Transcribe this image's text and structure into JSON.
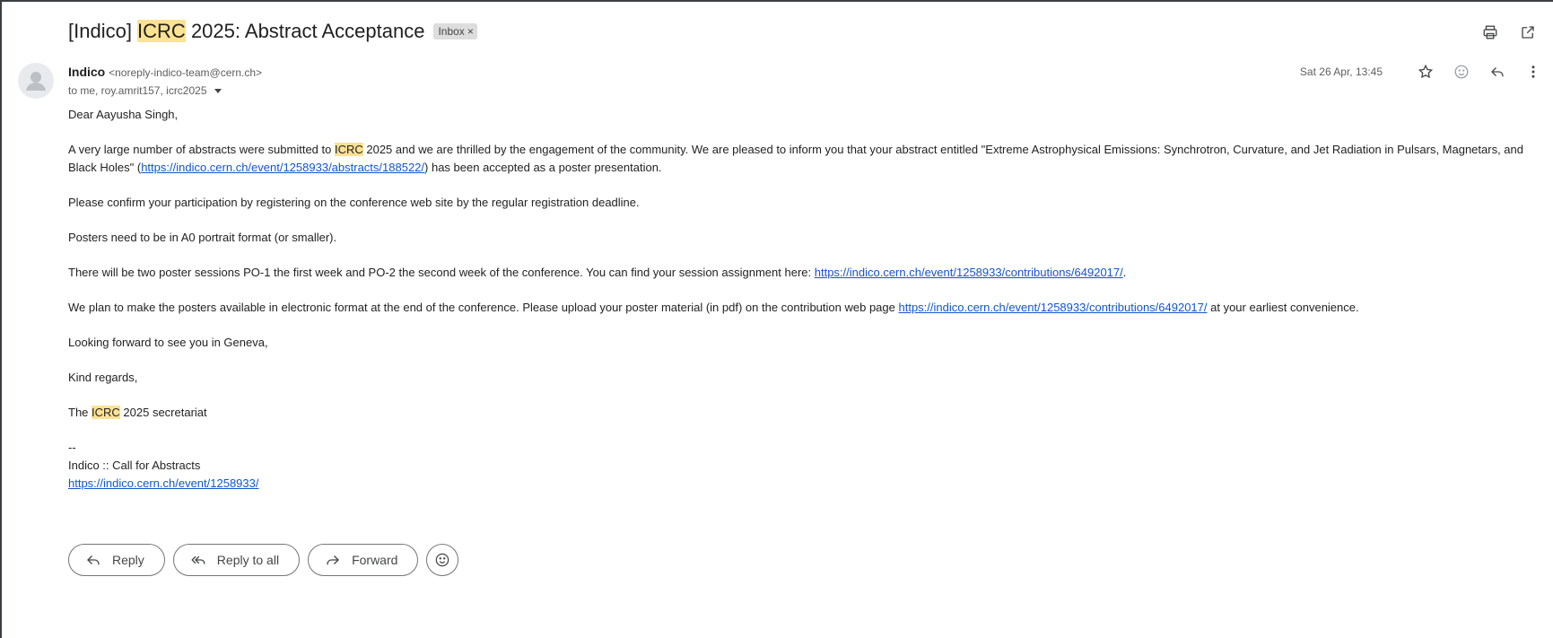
{
  "subject": {
    "prefix": "[Indico] ",
    "highlight": "ICRC",
    "suffix": " 2025: Abstract Acceptance",
    "label": "Inbox",
    "label_close": "×"
  },
  "sender": {
    "name": "Indico",
    "email": "<noreply-indico-team@cern.ch>",
    "recipients": "to me, roy.amrit157, icrc2025",
    "date": "Sat 26 Apr, 13:45"
  },
  "body": {
    "greeting": "Dear  Aayusha Singh,",
    "p1_a": "A very large number of abstracts were submitted to ",
    "p1_hl": "ICRC",
    "p1_b": " 2025 and we are thrilled by the engagement of the community. We are pleased to inform you that your abstract entitled \"Extreme Astrophysical Emissions: Synchrotron, Curvature, and Jet Radiation in Pulsars, Magnetars, and Black Holes\" (",
    "p1_link": "https://indico.cern.ch/event/1258933/abstracts/188522/",
    "p1_c": ") has been accepted as a poster presentation.",
    "p2": "Please confirm your participation by registering on the conference web site by the regular registration deadline.",
    "p3": "Posters need to be in A0 portrait format (or smaller).",
    "p4_a": "There will be two poster sessions PO-1 the first week and PO-2 the second week of the conference. You can find your session assignment here: ",
    "p4_link": "https://indico.cern.ch/event/1258933/contributions/6492017/",
    "p4_b": ".",
    "p5_a": "We plan to make the posters available in electronic format at the end of the conference. Please upload your poster material (in pdf) on the contribution web page ",
    "p5_link": "https://indico.cern.ch/event/1258933/contributions/6492017/",
    "p5_b": " at your earliest convenience.",
    "p6": "Looking forward to see you in Geneva,",
    "p7": "Kind regards,",
    "p8_a": "The ",
    "p8_hl": "ICRC",
    "p8_b": " 2025 secretariat",
    "sig_dash": "--",
    "sig_line": "Indico :: Call for Abstracts",
    "sig_link": "https://indico.cern.ch/event/1258933/"
  },
  "actions": {
    "reply": "Reply",
    "reply_all": "Reply to all",
    "forward": "Forward"
  },
  "icons": {
    "top": [
      "print-icon",
      "open-in-new-window-icon"
    ],
    "meta": [
      "star-icon",
      "emoji-icon",
      "reply-icon",
      "more-vert-icon"
    ]
  },
  "colors": {
    "highlight": "#fde293",
    "link": "#1155cc",
    "label_bg": "#dddddd"
  }
}
